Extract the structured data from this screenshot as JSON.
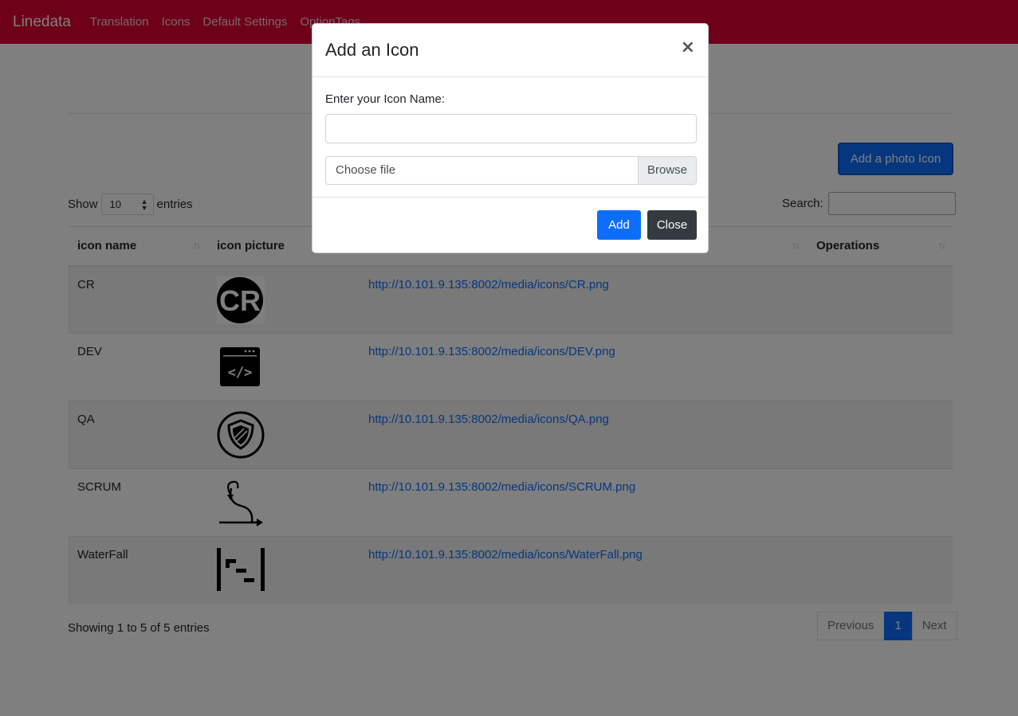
{
  "navbar": {
    "brand": "Linedata",
    "links": [
      "Translation",
      "Icons",
      "Default Settings",
      "OptionTags"
    ],
    "color": "#dc0032"
  },
  "page": {
    "add_photo_button": "Add a photo Icon",
    "show_label": "Show",
    "entries_value": "10",
    "entries_label": "entries",
    "search_label": "Search:",
    "columns": [
      "icon name",
      "icon picture",
      "",
      "Operations"
    ],
    "rows": [
      {
        "name": "CR",
        "icon": "cr-logo-icon",
        "url": "http://10.101.9.135:8002/media/icons/CR.png"
      },
      {
        "name": "DEV",
        "icon": "code-window-icon",
        "url": "http://10.101.9.135:8002/media/icons/DEV.png"
      },
      {
        "name": "QA",
        "icon": "shield-icon",
        "url": "http://10.101.9.135:8002/media/icons/QA.png"
      },
      {
        "name": "SCRUM",
        "icon": "sprint-cycle-icon",
        "url": "http://10.101.9.135:8002/media/icons/SCRUM.png"
      },
      {
        "name": "WaterFall",
        "icon": "waterfall-icon",
        "url": "http://10.101.9.135:8002/media/icons/WaterFall.png"
      }
    ],
    "showing_text": "Showing 1 to 5 of 5 entries",
    "pagination": {
      "previous": "Previous",
      "current": "1",
      "next": "Next"
    }
  },
  "modal": {
    "title": "Add an Icon",
    "close_symbol": "×",
    "name_label": "Enter your Icon Name:",
    "name_value": "",
    "file_placeholder": "Choose file",
    "browse_label": "Browse",
    "add_button": "Add",
    "close_button": "Close"
  }
}
